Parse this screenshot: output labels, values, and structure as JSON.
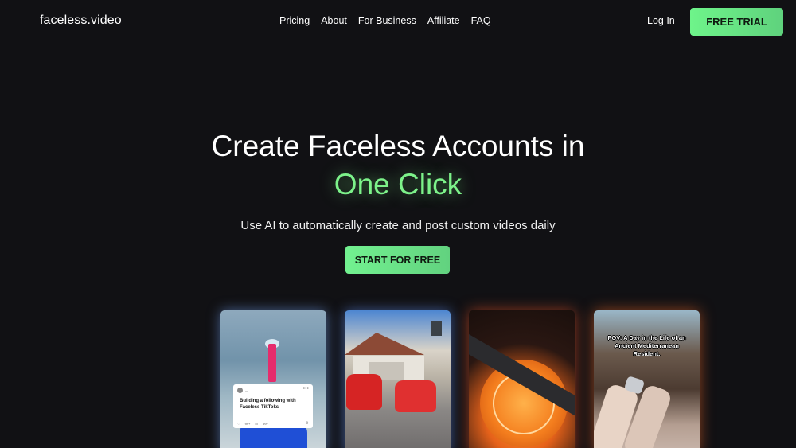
{
  "header": {
    "logo": "faceless.video",
    "nav": [
      "Pricing",
      "About",
      "For Business",
      "Affiliate",
      "FAQ"
    ],
    "login": "Log In",
    "free_trial": "FREE TRIAL"
  },
  "hero": {
    "title": "Create Faceless Accounts in",
    "accent": "One Click",
    "subtitle": "Use AI to automatically create and post custom videos daily",
    "cta": "START FOR FREE"
  },
  "cards": {
    "card1": {
      "post_text": "Building a following with Faceless TikToks",
      "likes": "99+",
      "comments": "99+"
    },
    "card4": {
      "caption": "POV: A Day in the Life of an Ancient Mediterranean Resident."
    }
  },
  "colors": {
    "background": "#111114",
    "accent_green": "#7df28a",
    "button_green": "#6ef48a"
  }
}
